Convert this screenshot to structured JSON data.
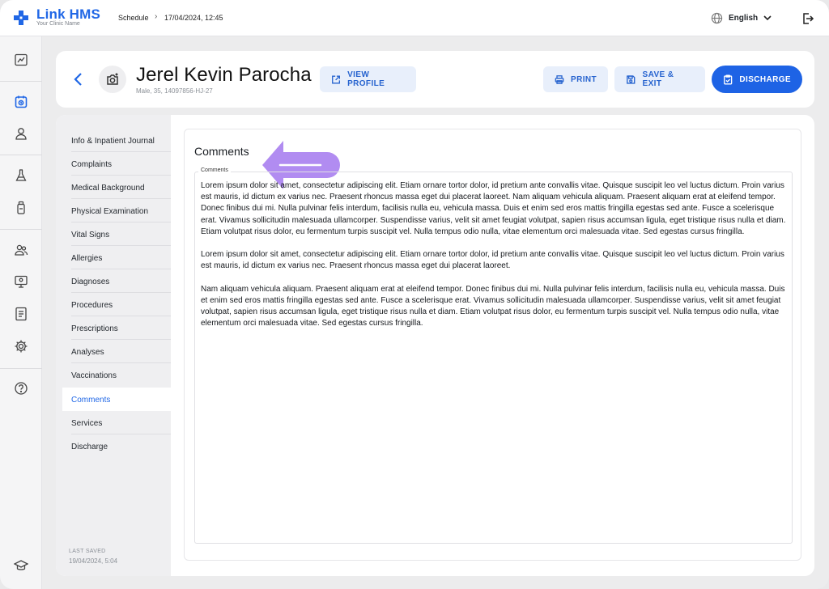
{
  "app": {
    "name": "Link HMS",
    "subtitle": "Your Clinic Name",
    "brand_color": "#2067e6"
  },
  "topbar": {
    "breadcrumb": [
      "Schedule",
      "17/04/2024, 12:45"
    ],
    "breadcrumb_separator": "›",
    "language": "English"
  },
  "rail": {
    "icons": [
      "dashboard-icon",
      "calendar-icon",
      "user-icon",
      "flask-icon",
      "bottle-icon",
      "users-icon",
      "monitor-icon",
      "document-icon",
      "settings-icon",
      "help-icon",
      "graduation-icon"
    ],
    "active": "calendar-icon"
  },
  "patient": {
    "name": "Jerel Kevin Parocha",
    "meta": "Male, 35, 14097856-HJ-27"
  },
  "header": {
    "view_profile": "VIEW PROFILE",
    "print": "PRINT",
    "save_exit": "SAVE & EXIT",
    "discharge": "DISCHARGE"
  },
  "nav": {
    "items": [
      {
        "label": "Info & Inpatient Journal"
      },
      {
        "label": "Complaints"
      },
      {
        "label": "Medical Background"
      },
      {
        "label": "Physical Examination"
      },
      {
        "label": "Vital Signs"
      },
      {
        "label": "Allergies"
      },
      {
        "label": "Diagnoses"
      },
      {
        "label": "Procedures"
      },
      {
        "label": "Prescriptions"
      },
      {
        "label": "Analyses"
      },
      {
        "label": "Vaccinations"
      },
      {
        "label": "Comments"
      },
      {
        "label": "Services"
      },
      {
        "label": "Discharge"
      }
    ],
    "active": "Comments",
    "last_saved_label": "LAST SAVED",
    "last_saved_value": "19/04/2024, 5:04"
  },
  "comments": {
    "title": "Comments",
    "field_label": "Comments",
    "paragraphs": [
      "Lorem ipsum dolor sit amet, consectetur adipiscing elit. Etiam ornare tortor dolor, id pretium ante convallis vitae. Quisque suscipit leo vel luctus dictum. Proin varius est mauris, id dictum ex varius nec. Praesent rhoncus massa eget dui placerat laoreet. Nam aliquam vehicula aliquam. Praesent aliquam erat at eleifend tempor. Donec finibus dui mi. Nulla pulvinar felis interdum, facilisis nulla eu, vehicula massa. Duis et enim sed eros mattis fringilla egestas sed ante. Fusce a scelerisque erat. Vivamus sollicitudin malesuada ullamcorper. Suspendisse varius, velit sit amet feugiat volutpat, sapien risus accumsan ligula, eget tristique risus nulla et diam. Etiam volutpat risus dolor, eu fermentum turpis suscipit vel. Nulla tempus odio nulla, vitae elementum orci malesuada vitae. Sed egestas cursus fringilla.",
      "Lorem ipsum dolor sit amet, consectetur adipiscing elit. Etiam ornare tortor dolor, id pretium ante convallis vitae. Quisque suscipit leo vel luctus dictum. Proin varius est mauris, id dictum ex varius nec. Praesent rhoncus massa eget dui placerat laoreet.",
      "Nam aliquam vehicula aliquam. Praesent aliquam erat at eleifend tempor. Donec finibus dui mi. Nulla pulvinar felis interdum, facilisis nulla eu, vehicula massa. Duis et enim sed eros mattis fringilla egestas sed ante. Fusce a scelerisque erat. Vivamus sollicitudin malesuada ullamcorper. Suspendisse varius, velit sit amet feugiat volutpat, sapien risus accumsan ligula, eget tristique risus nulla et diam. Etiam volutpat risus dolor, eu fermentum turpis suscipit vel. Nulla tempus odio nulla, vitae elementum orci malesuada vitae. Sed egestas cursus fringilla."
    ]
  },
  "annotation": {
    "arrow_color": "#a87ff0"
  }
}
